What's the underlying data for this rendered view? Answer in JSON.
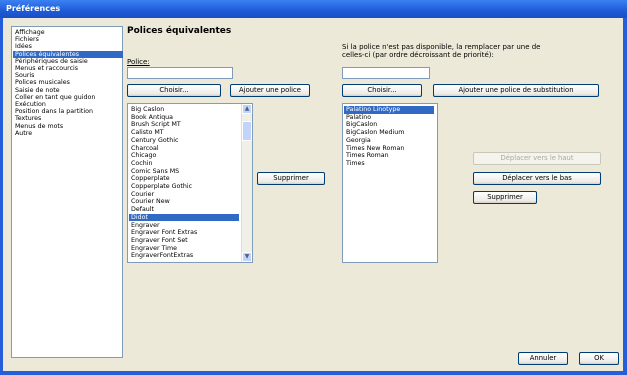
{
  "window": {
    "title": "Préférences"
  },
  "categories": [
    "Affichage",
    "Fichiers",
    "Idées",
    "Polices équivalentes",
    "Périphériques de saisie",
    "Menus et raccourcis",
    "Souris",
    "Polices musicales",
    "Saisie de note",
    "Coller en tant que guidon",
    "Exécution",
    "Position dans la partition",
    "Textures",
    "Menus de mots",
    "Autre"
  ],
  "selected_category": "Polices équivalentes",
  "panel": {
    "title": "Polices équivalentes",
    "police_label": "Police:",
    "police_value": "",
    "choose_label": "Choisir...",
    "add_font_label": "Ajouter une police",
    "delete_label": "Supprimer",
    "substitute_hint_line1": "Si la police n'est pas disponible, la remplacer par une de",
    "substitute_hint_line2": "celles-ci (par ordre décroissant de priorité):",
    "substitute_value": "",
    "choose2_label": "Choisir...",
    "add_substitute_label": "Ajouter une police de substitution",
    "move_up_label": "Déplacer vers le haut",
    "move_down_label": "Déplacer vers le bas",
    "delete2_label": "Supprimer"
  },
  "fonts": [
    "Big Caslon",
    "Book Antiqua",
    "Brush Script MT",
    "Calisto MT",
    "Century Gothic",
    "Charcoal",
    "Chicago",
    "Cochin",
    "Comic Sans MS",
    "Copperplate",
    "Copperplate Gothic",
    "Courier",
    "Courier New",
    "Default",
    "Didot",
    "Engraver",
    "Engraver Font Extras",
    "Engraver Font Set",
    "Engraver Time",
    "EngraverFontExtras"
  ],
  "selected_font": "Didot",
  "substitutes": [
    "Palatino Linotype",
    "Palatino",
    "BigCaslon",
    "BigCaslon Medium",
    "Georgia",
    "Times New Roman",
    "Times Roman",
    "Times"
  ],
  "selected_substitute": "Palatino Linotype",
  "footer": {
    "cancel_label": "Annuler",
    "ok_label": "OK"
  },
  "icons": {
    "scroll_up": "scroll-up-arrow-icon",
    "scroll_down": "scroll-down-arrow-icon"
  }
}
